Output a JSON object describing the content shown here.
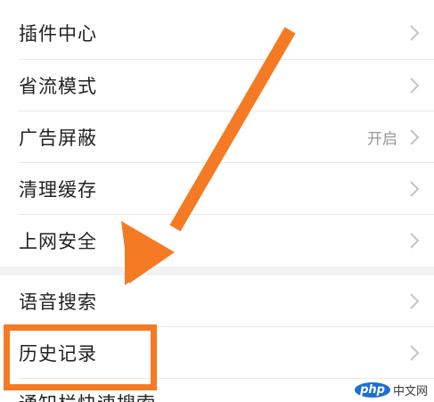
{
  "settings": {
    "group1": [
      {
        "label": "插件中心",
        "value": ""
      },
      {
        "label": "省流模式",
        "value": ""
      },
      {
        "label": "广告屏蔽",
        "value": "开启"
      },
      {
        "label": "清理缓存",
        "value": ""
      },
      {
        "label": "上网安全",
        "value": ""
      }
    ],
    "group2": [
      {
        "label": "语音搜索",
        "value": ""
      },
      {
        "label": "历史记录",
        "value": ""
      },
      {
        "label": "通知栏快速搜索",
        "value": ""
      }
    ]
  },
  "annotation": {
    "highlight_target": "历史记录",
    "arrow_color": "#f47b23",
    "box_color": "#f47b23"
  },
  "watermark": {
    "logo": "php",
    "text": "中文网"
  },
  "colors": {
    "label": "#222222",
    "value": "#9a9a9a",
    "chevron": "#c4c4c4",
    "divider": "#e8e8e8",
    "section_gap": "#f2f2f2"
  }
}
